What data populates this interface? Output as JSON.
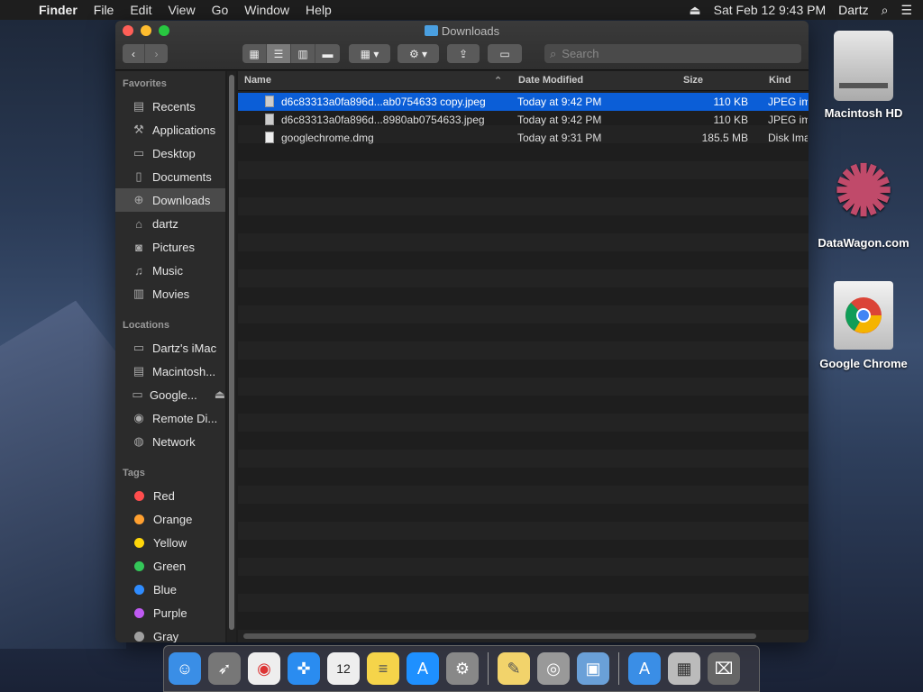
{
  "menubar": {
    "app": "Finder",
    "items": [
      "File",
      "Edit",
      "View",
      "Go",
      "Window",
      "Help"
    ],
    "clock": "Sat Feb 12  9:43 PM",
    "user": "Dartz"
  },
  "window": {
    "title": "Downloads",
    "search_placeholder": "Search"
  },
  "sidebar": {
    "favorites_header": "Favorites",
    "favorites": [
      {
        "label": "Recents",
        "icon": "recents-icon"
      },
      {
        "label": "Applications",
        "icon": "applications-icon"
      },
      {
        "label": "Desktop",
        "icon": "desktop-icon"
      },
      {
        "label": "Documents",
        "icon": "documents-icon"
      },
      {
        "label": "Downloads",
        "icon": "downloads-icon",
        "selected": true
      },
      {
        "label": "dartz",
        "icon": "home-icon"
      },
      {
        "label": "Pictures",
        "icon": "pictures-icon"
      },
      {
        "label": "Music",
        "icon": "music-icon"
      },
      {
        "label": "Movies",
        "icon": "movies-icon"
      }
    ],
    "locations_header": "Locations",
    "locations": [
      {
        "label": "Dartz's iMac"
      },
      {
        "label": "Macintosh..."
      },
      {
        "label": "Google..."
      },
      {
        "label": "Remote Di..."
      },
      {
        "label": "Network"
      }
    ],
    "tags_header": "Tags",
    "tags": [
      {
        "label": "Red",
        "color": "#ff4d4d"
      },
      {
        "label": "Orange",
        "color": "#ffa030"
      },
      {
        "label": "Yellow",
        "color": "#ffd60a"
      },
      {
        "label": "Green",
        "color": "#34c759"
      },
      {
        "label": "Blue",
        "color": "#2f8cff"
      },
      {
        "label": "Purple",
        "color": "#bf5af2"
      },
      {
        "label": "Gray",
        "color": "#a0a0a0"
      }
    ]
  },
  "columns": {
    "name": "Name",
    "date": "Date Modified",
    "size": "Size",
    "kind": "Kind"
  },
  "files": [
    {
      "name": "d6c83313a0fa896d...ab0754633 copy.jpeg",
      "date": "Today at 9:42 PM",
      "size": "110 KB",
      "kind": "JPEG image",
      "selected": true
    },
    {
      "name": "d6c83313a0fa896d...8980ab0754633.jpeg",
      "date": "Today at 9:42 PM",
      "size": "110 KB",
      "kind": "JPEG image"
    },
    {
      "name": "googlechrome.dmg",
      "date": "Today at 9:31 PM",
      "size": "185.5 MB",
      "kind": "Disk Image"
    }
  ],
  "desktop": [
    {
      "label": "Macintosh HD"
    },
    {
      "label": "DataWagon.com"
    },
    {
      "label": "Google Chrome"
    }
  ],
  "dock": [
    {
      "name": "finder-icon",
      "glyph": "☺",
      "color": "#3a8ee6"
    },
    {
      "name": "launchpad-icon",
      "glyph": "🚀",
      "color": "#777"
    },
    {
      "name": "chrome-icon",
      "glyph": "◉",
      "color": "#d33"
    },
    {
      "name": "safari-icon",
      "glyph": "🧭",
      "color": "#2a8cf0"
    },
    {
      "name": "calendar-icon",
      "glyph": "12",
      "color": "#eee"
    },
    {
      "name": "notes-icon",
      "glyph": "≡",
      "color": "#f5d44a"
    },
    {
      "name": "app-store-icon",
      "glyph": "A",
      "color": "#1e90ff"
    },
    {
      "name": "system-preferences-icon",
      "glyph": "⚙",
      "color": "#888"
    },
    {
      "name": "stickies-icon",
      "glyph": "✎",
      "color": "#f2d36b"
    },
    {
      "name": "image-capture-icon",
      "glyph": "◎",
      "color": "#999"
    },
    {
      "name": "preview-icon",
      "glyph": "▣",
      "color": "#6aa0d8"
    },
    {
      "name": "app-store-folder-icon",
      "glyph": "A",
      "color": "#3a8ee6"
    },
    {
      "name": "downloads-stack-icon",
      "glyph": "▦",
      "color": "#bbb"
    },
    {
      "name": "trash-icon",
      "glyph": "🗑",
      "color": "#666"
    }
  ]
}
